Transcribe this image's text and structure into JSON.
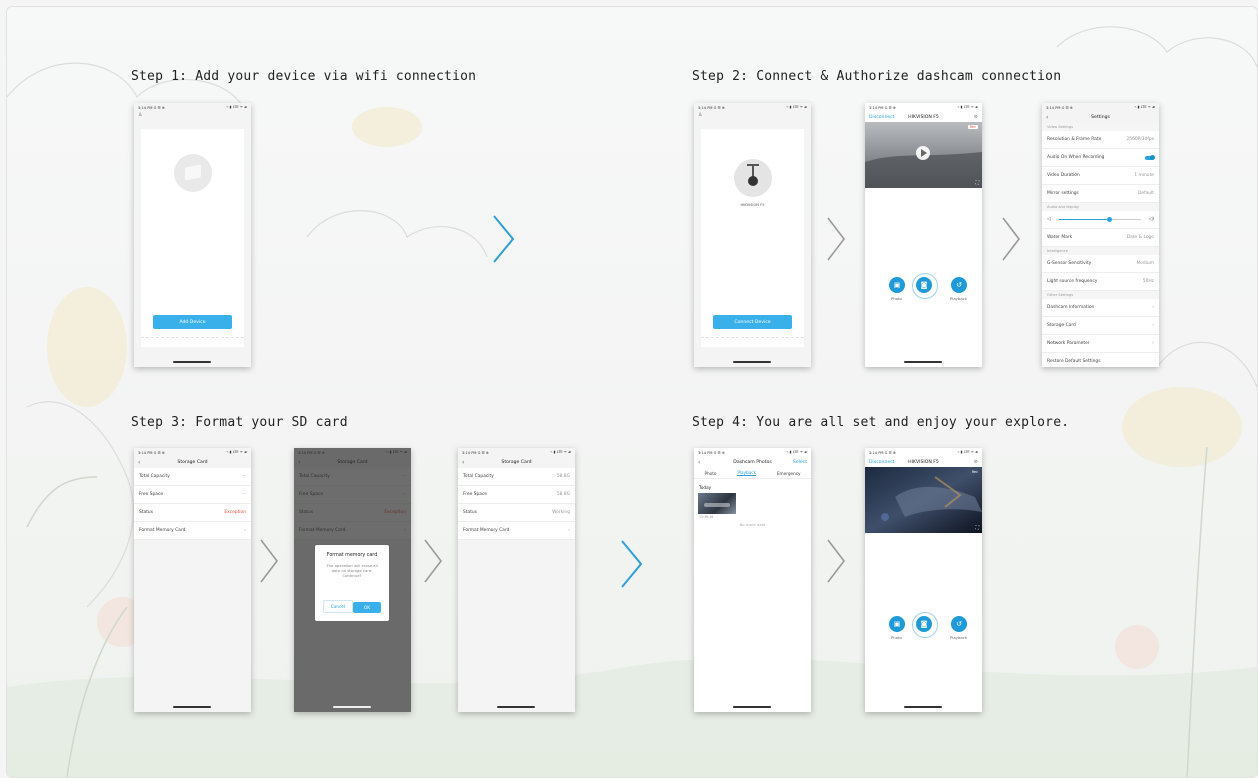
{
  "steps": {
    "s1": "Step 1: Add your device via wifi connection",
    "s2": "Step 2: Connect & Authorize dashcam connection",
    "s3": "Step 3: Format your SD card",
    "s4": "Step 4: You are all set and enjoy your explore."
  },
  "status_bar": {
    "time": "3:14 PM G ☰ ⊕",
    "icons": "⌁ ▮ LTE ᯤ ▰"
  },
  "p1": {
    "add_device": "Add Device"
  },
  "p2": {
    "device_name": "HIKVISION F5",
    "connect_device": "Connect Device"
  },
  "p3": {
    "disconnect": "Disconnect",
    "title": "HIKVISION F5",
    "record_badge": "Rec",
    "photo": "Photo",
    "playback": "Playback"
  },
  "settings": {
    "title": "Settings",
    "sections": {
      "video": "Video Settings",
      "audio": "Audio and display",
      "intel": "Intelligence",
      "other": "Other Settings"
    },
    "rows": {
      "resolution": "Resolution & Frame Rate",
      "resolution_v": "2560P/30fps",
      "audio_on": "Audio On When Recording",
      "duration": "Video Duration",
      "duration_v": "1 minute",
      "mirror": "Mirror settings",
      "mirror_v": "Default",
      "watermark": "Water Mark",
      "watermark_v": "Date & Logo",
      "gsensor": "G-Sensor Sensitivity",
      "gsensor_v": "Medium",
      "light": "Light source frequency",
      "light_v": "50Hz",
      "info": "Dashcam Information",
      "storage": "Storage Card",
      "network": "Network Parameter",
      "restore": "Restore Default Settings"
    }
  },
  "storage": {
    "title": "Storage Card",
    "total": "Total Capacity",
    "total_v": "--",
    "free": "Free Space",
    "free_v": "--",
    "status": "Status",
    "status_v": "Exception",
    "format": "Format Memory Card",
    "total_v2": "58.8G",
    "free_v2": "58.8G",
    "status_v2": "Working"
  },
  "dialog": {
    "title": "Format memory card",
    "message": "The operation will erase all data on storage card. Continue?",
    "cancel": "Cancel",
    "ok": "OK"
  },
  "photos": {
    "title": "Dashcam Photos",
    "select": "Select",
    "tabs": [
      "Photo",
      "Playback",
      "Emergency"
    ],
    "today": "Today",
    "thumb_time": "15:36:18",
    "no_more": "No more data"
  },
  "colors": {
    "accent": "#2aa3e0",
    "button": "#3ab0ea",
    "chevron": "#2f9fd6"
  }
}
